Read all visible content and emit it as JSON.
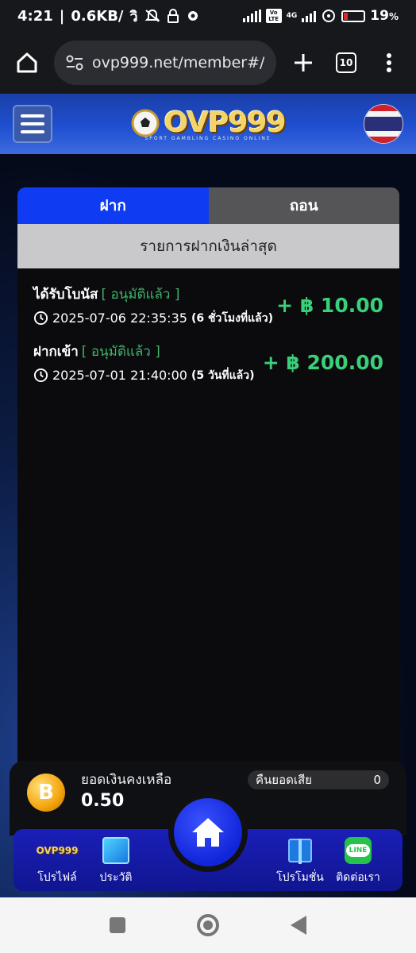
{
  "status_bar": {
    "time": "4:21",
    "network_speed": "0.6KB/",
    "extra": "วิ",
    "battery": "19",
    "battery_unit": "%",
    "network_type": "4G",
    "volte": "Vo LTE"
  },
  "browser": {
    "url": "ovp999.net/member#/",
    "tab_count": "10"
  },
  "site": {
    "logo_text": "OVP999",
    "logo_subtitle": "SPORT GAMBLING CASINO ONLINE"
  },
  "tabs": {
    "deposit": "ฝาก",
    "withdraw": "ถอน"
  },
  "section_title": "รายการฝากเงินล่าสุด",
  "transactions": [
    {
      "title": "ได้รับโบนัส",
      "status": "[ อนุมัติแล้ว ]",
      "datetime": "2025-07-06 22:35:35",
      "ago": "(6 ชั่วโมงที่แล้ว)",
      "amount": "+ ฿ 10.00"
    },
    {
      "title": "ฝากเข้า",
      "status": "[ อนุมัติแล้ว ]",
      "datetime": "2025-07-01 21:40:00",
      "ago": "(5 วันที่แล้ว)",
      "amount": "+ ฿ 200.00"
    }
  ],
  "balance": {
    "label": "ยอดเงินคงเหลือ",
    "value": "0.50",
    "coin_symbol": "B",
    "cashback_label": "คืนยอดเสีย",
    "cashback_value": "0"
  },
  "bottom_nav": {
    "profile": "โปรไฟล์",
    "history": "ประวัติ",
    "promotion": "โปรโมชั่น",
    "contact": "ติดต่อเรา",
    "profile_logo": "OVP999",
    "line_text": "LINE"
  },
  "colors": {
    "active_tab": "#0f3cf2",
    "amount_green": "#3ad07a",
    "status_green": "#3fb36a",
    "header_blue": "#1f4fd0"
  }
}
